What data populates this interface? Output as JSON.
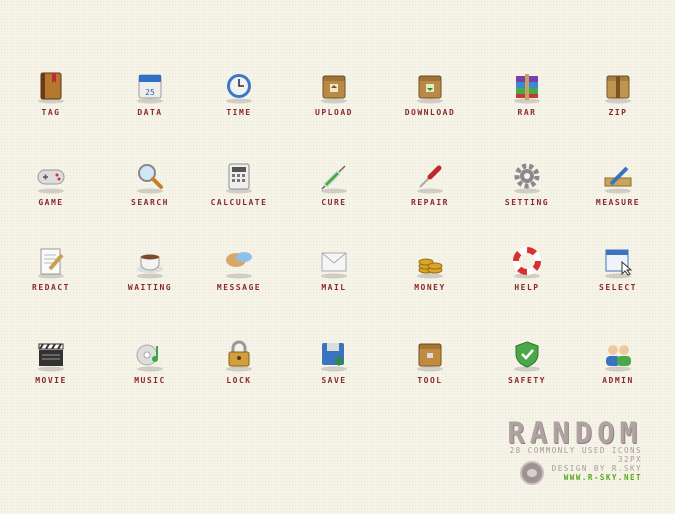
{
  "icons": [
    {
      "label": "Tag",
      "icon": "book-icon",
      "color": "#b5782f"
    },
    {
      "label": "Data",
      "icon": "calendar-icon",
      "color": "#2f6fc4",
      "text": "25"
    },
    {
      "label": "Time",
      "icon": "clock-icon",
      "color": "#3d78c8"
    },
    {
      "label": "Upload",
      "icon": "upload-box-icon",
      "color": "#b88a45"
    },
    {
      "label": "Download",
      "icon": "download-box-icon",
      "color": "#b88a45"
    },
    {
      "label": "RAR",
      "icon": "archive-books-icon",
      "color": "#8a3fa8"
    },
    {
      "label": "Zip",
      "icon": "package-icon",
      "color": "#c09552"
    },
    {
      "label": "Game",
      "icon": "gamepad-icon",
      "color": "#9a9a9a"
    },
    {
      "label": "Search",
      "icon": "magnifier-icon",
      "color": "#c77d2e"
    },
    {
      "label": "Calculate",
      "icon": "calculator-icon",
      "color": "#8c8c8c"
    },
    {
      "label": "Cure",
      "icon": "syringe-icon",
      "color": "#4aa84a"
    },
    {
      "label": "Repair",
      "icon": "screwdriver-icon",
      "color": "#c0282a"
    },
    {
      "label": "Setting",
      "icon": "gear-icon",
      "color": "#8a8a8a"
    },
    {
      "label": "Measure",
      "icon": "ruler-pencil-icon",
      "color": "#c9a55a"
    },
    {
      "label": "Redact",
      "icon": "notepad-pencil-icon",
      "color": "#c8a050"
    },
    {
      "label": "Waiting",
      "icon": "coffee-cup-icon",
      "color": "#7a4a2a"
    },
    {
      "label": "Message",
      "icon": "speech-bubbles-icon",
      "color": "#d8a868"
    },
    {
      "label": "Mail",
      "icon": "envelope-icon",
      "color": "#cfcfcf"
    },
    {
      "label": "Money",
      "icon": "coins-icon",
      "color": "#d9a628"
    },
    {
      "label": "Help",
      "icon": "lifebuoy-icon",
      "color": "#d83030"
    },
    {
      "label": "Select",
      "icon": "window-cursor-icon",
      "color": "#3a74c0"
    },
    {
      "label": "Movie",
      "icon": "clapperboard-icon",
      "color": "#333333"
    },
    {
      "label": "Music",
      "icon": "cd-note-icon",
      "color": "#3aa84a"
    },
    {
      "label": "Lock",
      "icon": "padlock-icon",
      "color": "#d0a040"
    },
    {
      "label": "Save",
      "icon": "floppy-icon",
      "color": "#2f8a3a"
    },
    {
      "label": "Tool",
      "icon": "toolbox-icon",
      "color": "#c08a40"
    },
    {
      "label": "Safety",
      "icon": "shield-icon",
      "color": "#4aa84a"
    },
    {
      "label": "Admin",
      "icon": "users-icon",
      "color": "#3a74c0"
    }
  ],
  "brand": {
    "title": "RANDOM",
    "subtitle": "28 COMMONLY USED ICONS",
    "size": "32PX",
    "designer": "DESIGN BY R.SKY",
    "url": "WWW.R-SKY.NET"
  }
}
